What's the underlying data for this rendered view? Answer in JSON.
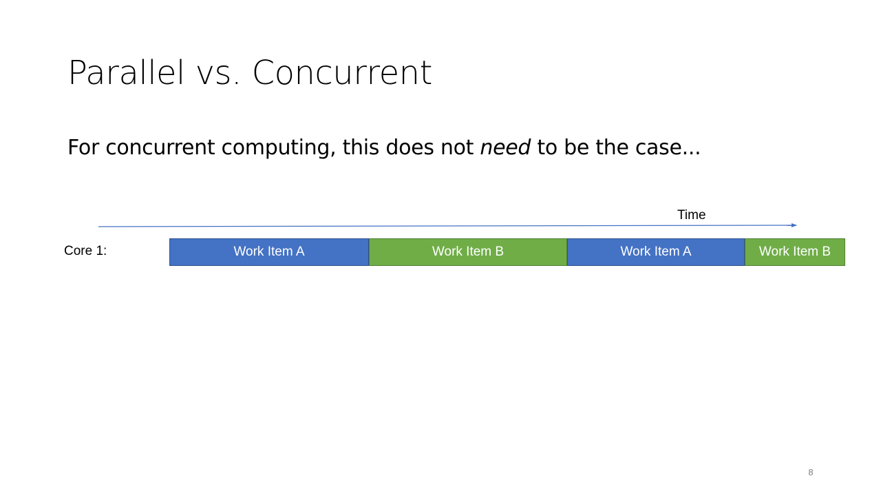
{
  "slide": {
    "title": "Parallel vs. Concurrent",
    "body_before": "For concurrent computing, this does not ",
    "body_emphasis": "need",
    "body_after": " to be the case...",
    "page_number": "8"
  },
  "diagram": {
    "axis_label": "Time",
    "row_label": "Core 1:",
    "blocks": [
      {
        "label": "Work Item A",
        "kind": "a"
      },
      {
        "label": "Work Item B",
        "kind": "b"
      },
      {
        "label": "Work Item A",
        "kind": "a"
      },
      {
        "label": "Work Item B",
        "kind": "b"
      }
    ]
  },
  "colors": {
    "work_item_a": "#4472c4",
    "work_item_b": "#70ad47",
    "arrow": "#4472c4"
  }
}
